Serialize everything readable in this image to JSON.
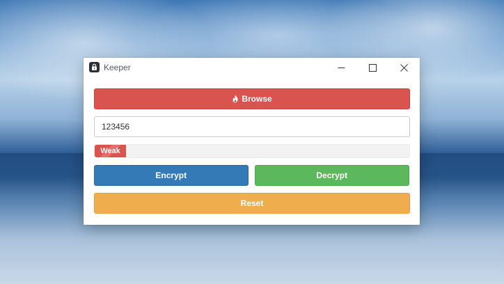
{
  "window": {
    "title": "Keeper",
    "controls": {
      "minimize_icon": "minimize-icon",
      "maximize_icon": "maximize-icon",
      "close_icon": "close-icon"
    }
  },
  "form": {
    "browse_label": "Browse",
    "browse_icon": "fire-icon",
    "password_value": "123456",
    "strength": {
      "label": "Weak",
      "level_fraction": 0.1,
      "color": "#d9534f"
    },
    "encrypt_label": "Encrypt",
    "decrypt_label": "Decrypt",
    "reset_label": "Reset"
  },
  "colors": {
    "browse": "#d9534f",
    "encrypt": "#337ab7",
    "decrypt": "#5cb85c",
    "reset": "#f0ad4e"
  }
}
